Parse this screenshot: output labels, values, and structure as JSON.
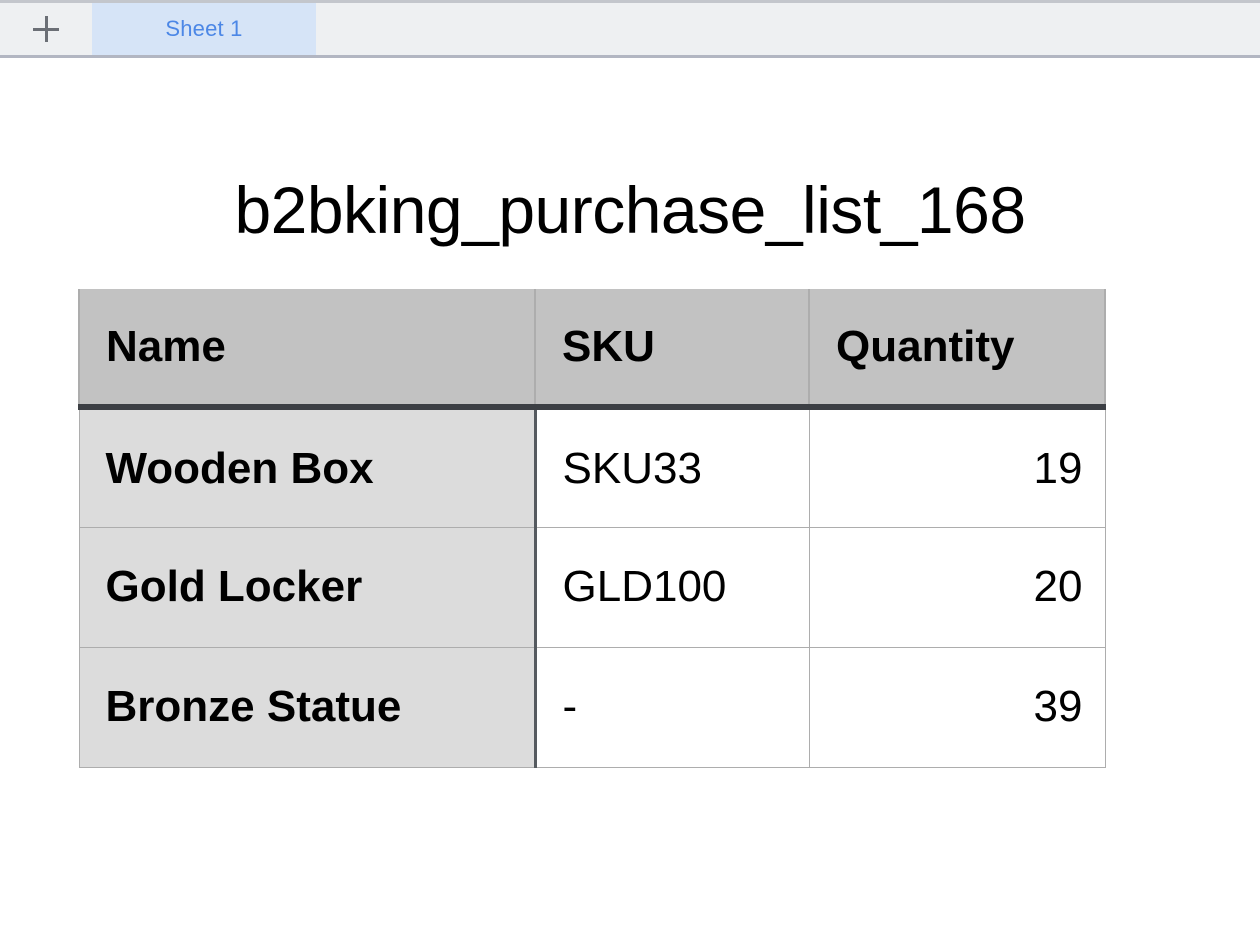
{
  "tabbar": {
    "add_sheet_icon": "plus-icon",
    "add_sheet_label": "+",
    "tabs": [
      {
        "label": "Sheet 1",
        "active": true
      }
    ],
    "active_tab_color": "#d6e4f7",
    "active_tab_text_color": "#4c87e6"
  },
  "document": {
    "title": "b2bking_purchase_list_168"
  },
  "table": {
    "columns": [
      "Name",
      "SKU",
      "Quantity"
    ],
    "header_bg": "#c2c2c2",
    "row_header_bg": "#dcdcdc",
    "rows": [
      {
        "name": "Wooden Box",
        "sku": "SKU33",
        "quantity": "19"
      },
      {
        "name": "Gold Locker",
        "sku": "GLD100",
        "quantity": "20"
      },
      {
        "name": "Bronze Statue",
        "sku": "-",
        "quantity": "39"
      }
    ]
  }
}
